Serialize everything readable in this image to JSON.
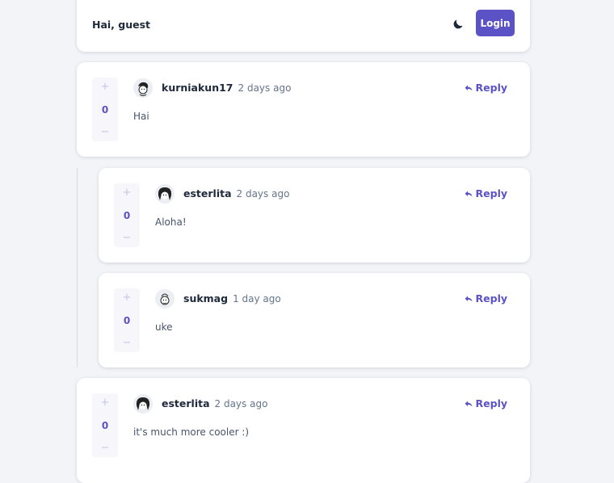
{
  "header": {
    "greeting": "Hai, guest",
    "login_label": "Login",
    "theme_icon": "moon-icon"
  },
  "comments": [
    {
      "username": "kurniakun17",
      "time": "2 days ago",
      "text": "Hai",
      "votes": "0",
      "reply_label": "Reply"
    },
    {
      "username": "esterlita",
      "time": "2 days ago",
      "text": "Aloha!",
      "votes": "0",
      "reply_label": "Reply"
    },
    {
      "username": "sukmag",
      "time": "1 day ago",
      "text": "uke",
      "votes": "0",
      "reply_label": "Reply"
    },
    {
      "username": "esterlita",
      "time": "2 days ago",
      "text": "it's much more cooler :)",
      "votes": "0",
      "reply_label": "Reply"
    }
  ],
  "vote": {
    "up_symbol": "+",
    "down_symbol": "−"
  },
  "colors": {
    "accent": "#5b52c6",
    "background": "#f3f4f8"
  }
}
